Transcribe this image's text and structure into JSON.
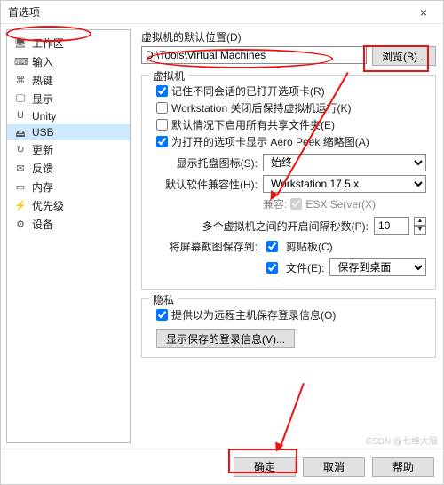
{
  "title": "首选项",
  "sidebar": {
    "items": [
      {
        "icon": "🖥",
        "label": "工作区"
      },
      {
        "icon": "⌨",
        "label": "输入"
      },
      {
        "icon": "⌘",
        "label": "热键"
      },
      {
        "icon": "🖵",
        "label": "显示"
      },
      {
        "icon": "U",
        "label": "Unity"
      },
      {
        "icon": "🖴",
        "label": "USB"
      },
      {
        "icon": "↻",
        "label": "更新"
      },
      {
        "icon": "✉",
        "label": "反馈"
      },
      {
        "icon": "▭",
        "label": "内存"
      },
      {
        "icon": "⚡",
        "label": "优先级"
      },
      {
        "icon": "⚙",
        "label": "设备"
      }
    ],
    "selected": 5
  },
  "defaultLocation": {
    "label": "虚拟机的默认位置(D)",
    "path": "D:\\Tools\\Virtual Machines",
    "browse": "浏览(B)..."
  },
  "vmGroup": {
    "title": "虚拟机",
    "chk1": {
      "checked": true,
      "label": "记住不同会话的已打开选项卡(R)"
    },
    "chk2": {
      "checked": false,
      "label": "Workstation 关闭后保持虚拟机运行(K)"
    },
    "chk3": {
      "checked": false,
      "label": "默认情况下启用所有共享文件夹(E)"
    },
    "chk4": {
      "checked": true,
      "label": "为打开的选项卡显示 Aero Peek 缩略图(A)"
    },
    "trayLabel": "显示托盘图标(S):",
    "trayValue": "始终",
    "compatLabel": "默认软件兼容性(H):",
    "compatValue": "Workstation 17.5.x",
    "compatSub": "兼容:",
    "esx": "ESX Server(X)",
    "delayLabel": "多个虚拟机之间的开启间隔秒数(P):",
    "delayValue": "10",
    "screenshotLabel": "将屏幕截图保存到:",
    "clipboard": "剪贴板(C)",
    "fileChk": "文件(E):",
    "fileDest": "保存到桌面"
  },
  "privacy": {
    "title": "隐私",
    "chk": {
      "checked": true,
      "label": "提供以为远程主机保存登录信息(O)"
    },
    "showBtn": "显示保存的登录信息(V)..."
  },
  "footer": {
    "ok": "确定",
    "cancel": "取消",
    "help": "帮助"
  },
  "watermark": "CSDN @七维大脑"
}
